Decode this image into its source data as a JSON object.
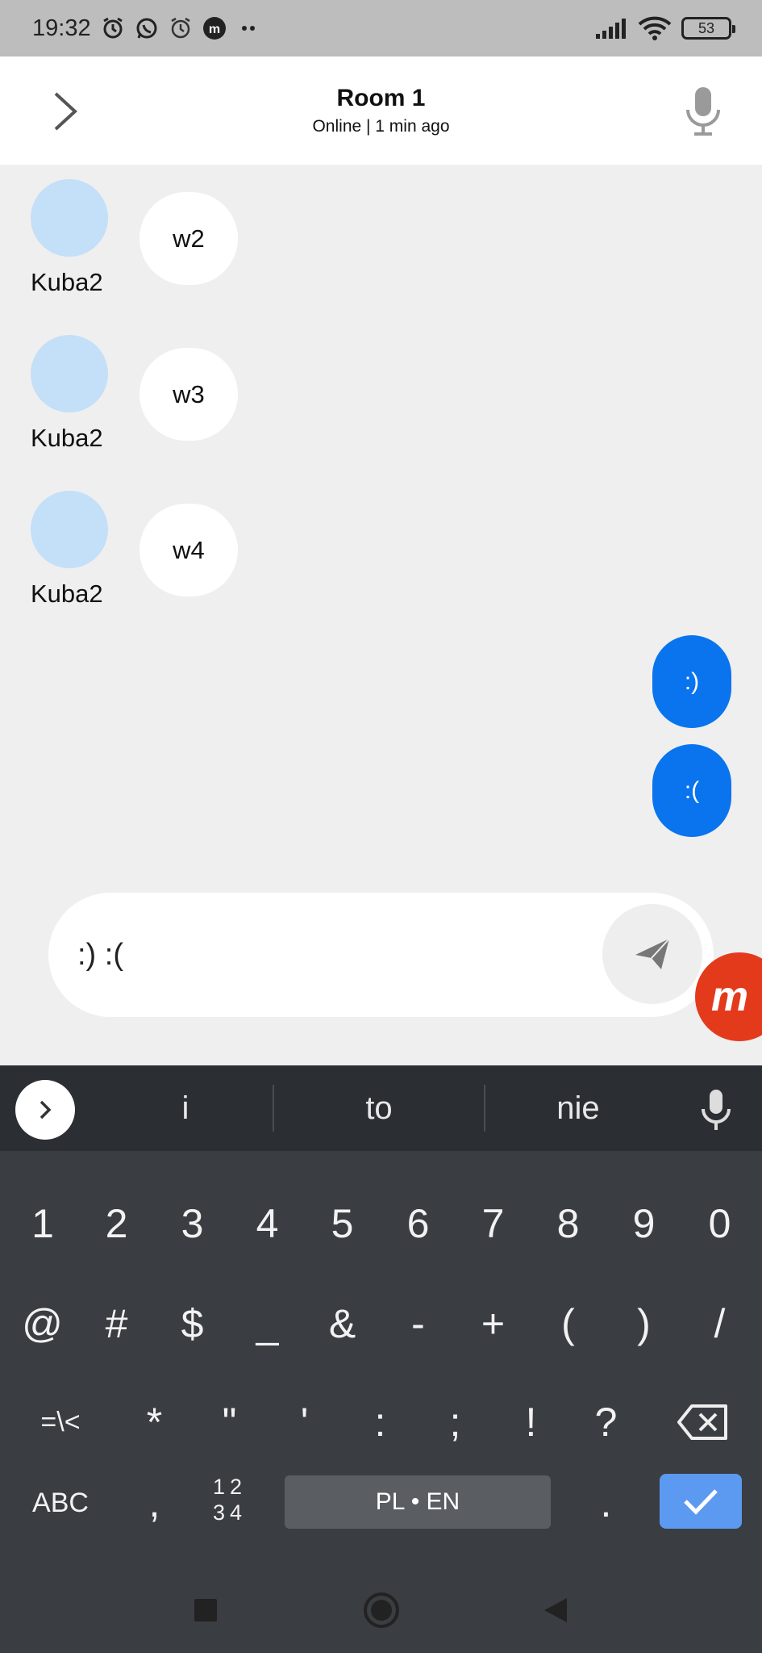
{
  "status_bar": {
    "time": "19:32",
    "battery": "53",
    "icons": [
      "alarm-clock-icon",
      "whatsapp-icon",
      "alarm-icon",
      "mobizen-icon",
      "more-dots-icon",
      "signal-icon",
      "wifi-icon",
      "battery-icon"
    ]
  },
  "header": {
    "title": "Room 1",
    "status": "Online | 1 min ago",
    "back_icon": "chevron-right-icon",
    "mic_icon": "microphone-icon"
  },
  "messages": [
    {
      "sender": "Kuba2",
      "text": "w2",
      "incoming": true
    },
    {
      "sender": "Kuba2",
      "text": "w3",
      "incoming": true
    },
    {
      "sender": "Kuba2",
      "text": "w4",
      "incoming": true
    },
    {
      "text": ":)",
      "incoming": false
    },
    {
      "text": ":(",
      "incoming": false
    }
  ],
  "composer": {
    "value": ":) :(",
    "send_icon": "send-icon"
  },
  "suggestions": [
    "i",
    "to",
    "nie"
  ],
  "keyboard": {
    "row1": [
      "1",
      "2",
      "3",
      "4",
      "5",
      "6",
      "7",
      "8",
      "9",
      "0"
    ],
    "row2": [
      "@",
      "#",
      "$",
      "_",
      "&",
      "-",
      "+",
      "(",
      ")",
      "/"
    ],
    "row3": [
      "=\\<",
      "*",
      "\"",
      "'",
      ":",
      ";",
      "!",
      "?"
    ],
    "abc": "ABC",
    "comma": ",",
    "numpad_top": "12",
    "numpad_bottom": "34",
    "language": "PL • EN",
    "period": "."
  },
  "colors": {
    "accent": "#0a74ef",
    "avatar": "#c4dff8",
    "done_key": "#5b9af0",
    "badge": "#e43a1c"
  }
}
